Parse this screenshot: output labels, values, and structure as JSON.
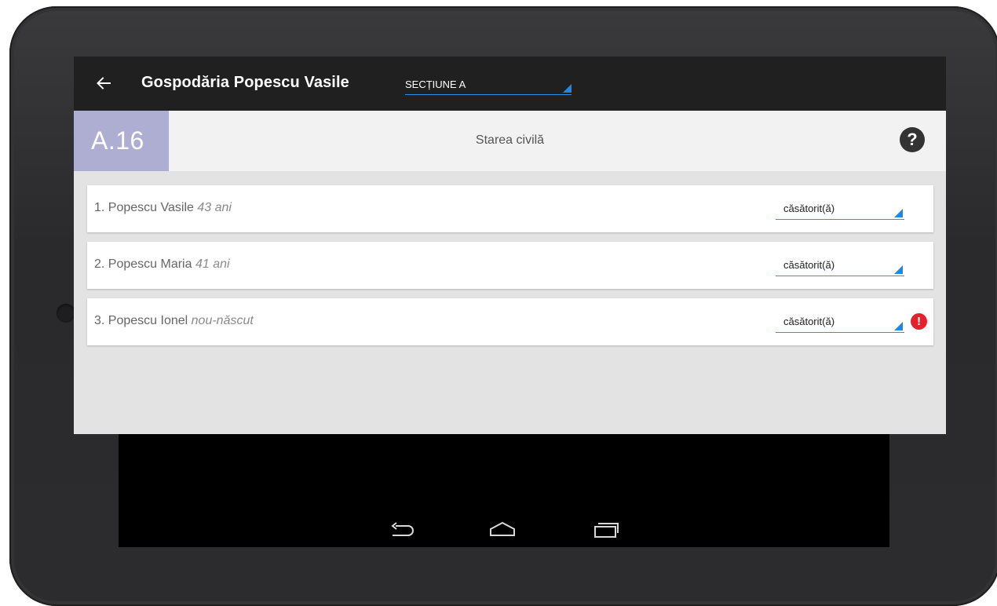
{
  "appbar": {
    "title": "Gospodăria Popescu Vasile",
    "section_selector": "SECȚIUNE A",
    "icons": {
      "back": "arrow-left-icon"
    }
  },
  "section": {
    "code": "A.16",
    "title": "Starea civilă",
    "help_icon": "question-mark-icon",
    "help_glyph": "?"
  },
  "persons": [
    {
      "name": "1. Popescu Vasile",
      "age": "43 ani",
      "status": "căsătorit(ă)",
      "error": false
    },
    {
      "name": "2. Popescu Maria",
      "age": "41 ani",
      "status": "căsătorit(ă)",
      "error": false
    },
    {
      "name": "3. Popescu Ionel",
      "age": "nou-născut",
      "status": "căsătorit(ă)",
      "error": true,
      "error_glyph": "!"
    }
  ],
  "colors": {
    "appbar": "#202020",
    "section_code_bg": "#aeaed3",
    "accent": "#1e88e5",
    "error": "#e5222c"
  },
  "nav_bar": {
    "icons": [
      "back-nav-icon",
      "home-nav-icon",
      "recents-nav-icon"
    ]
  }
}
